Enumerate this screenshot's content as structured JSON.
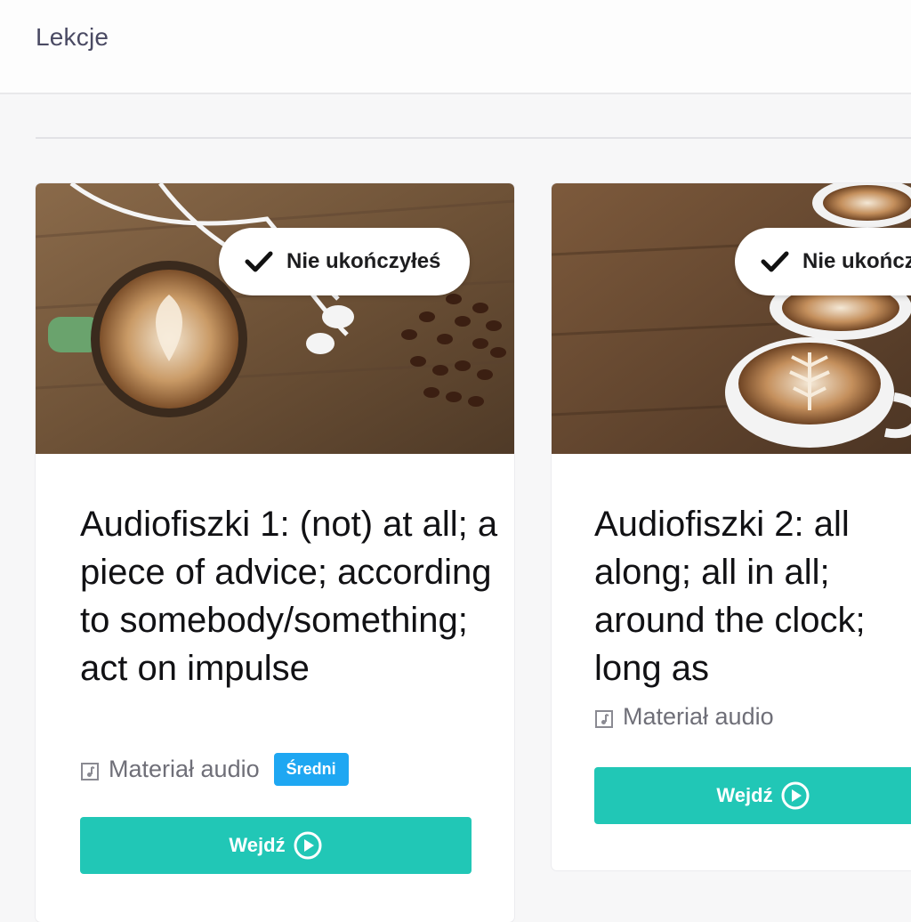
{
  "header": {
    "title": "Lekcje"
  },
  "cards": [
    {
      "status": "Nie ukończyłeś",
      "title": "Audiofiszki 1: (not) at all; a piece of advice; according to somebody/something; act on impulse",
      "material": "Materiał audio",
      "level": "Średni",
      "button": "Wejdź",
      "image": "coffee-with-earphones-and-beans"
    },
    {
      "status": "Nie ukończ",
      "title": "Audiofiszki 2: all along; all in all; around the clock; long as",
      "material": "Materiał audio",
      "button": "Wejdź",
      "image": "three-coffee-cups-on-wood"
    }
  ],
  "colors": {
    "accent": "#21c7b6",
    "badge": "#1ea7f2",
    "title_text": "#4a4a63"
  },
  "icons": [
    "check-icon",
    "music-note-icon",
    "play-circle-icon"
  ]
}
